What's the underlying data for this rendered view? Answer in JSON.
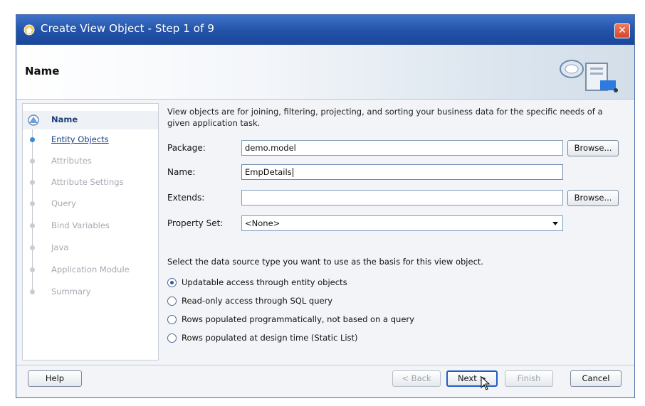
{
  "window": {
    "title": "Create View Object - Step 1 of 9",
    "close_symbol": "✕",
    "title_icon": "view-object-wizard-icon",
    "accent_color": "#2252a8"
  },
  "header": {
    "title": "Name"
  },
  "sidebar": {
    "items": [
      {
        "label": "Name",
        "state": "current"
      },
      {
        "label": "Entity Objects",
        "state": "link"
      },
      {
        "label": "Attributes",
        "state": "disabled"
      },
      {
        "label": "Attribute Settings",
        "state": "disabled"
      },
      {
        "label": "Query",
        "state": "disabled"
      },
      {
        "label": "Bind Variables",
        "state": "disabled"
      },
      {
        "label": "Java",
        "state": "disabled"
      },
      {
        "label": "Application Module",
        "state": "disabled"
      },
      {
        "label": "Summary",
        "state": "disabled"
      }
    ]
  },
  "main": {
    "description": "View objects are for joining, filtering, projecting, and sorting your business data for the specific needs of a given application task.",
    "package": {
      "label": "Package:",
      "value": "demo.model"
    },
    "name": {
      "label": "Name:",
      "value": "EmpDetails"
    },
    "extends": {
      "label": "Extends:",
      "value": ""
    },
    "property_set": {
      "label": "Property Set:",
      "value": "<None>"
    },
    "browse_label": "Browse...",
    "datasource_prompt": "Select the data source type you want to use as the basis for this view object.",
    "options": [
      {
        "label": "Updatable access through entity objects",
        "checked": true
      },
      {
        "label": "Read-only access through SQL query",
        "checked": false
      },
      {
        "label": "Rows populated programmatically, not based on a query",
        "checked": false
      },
      {
        "label": "Rows populated at design time (Static List)",
        "checked": false
      }
    ]
  },
  "footer": {
    "help": "Help",
    "back": "< Back",
    "next": "Next >",
    "finish": "Finish",
    "cancel": "Cancel"
  }
}
